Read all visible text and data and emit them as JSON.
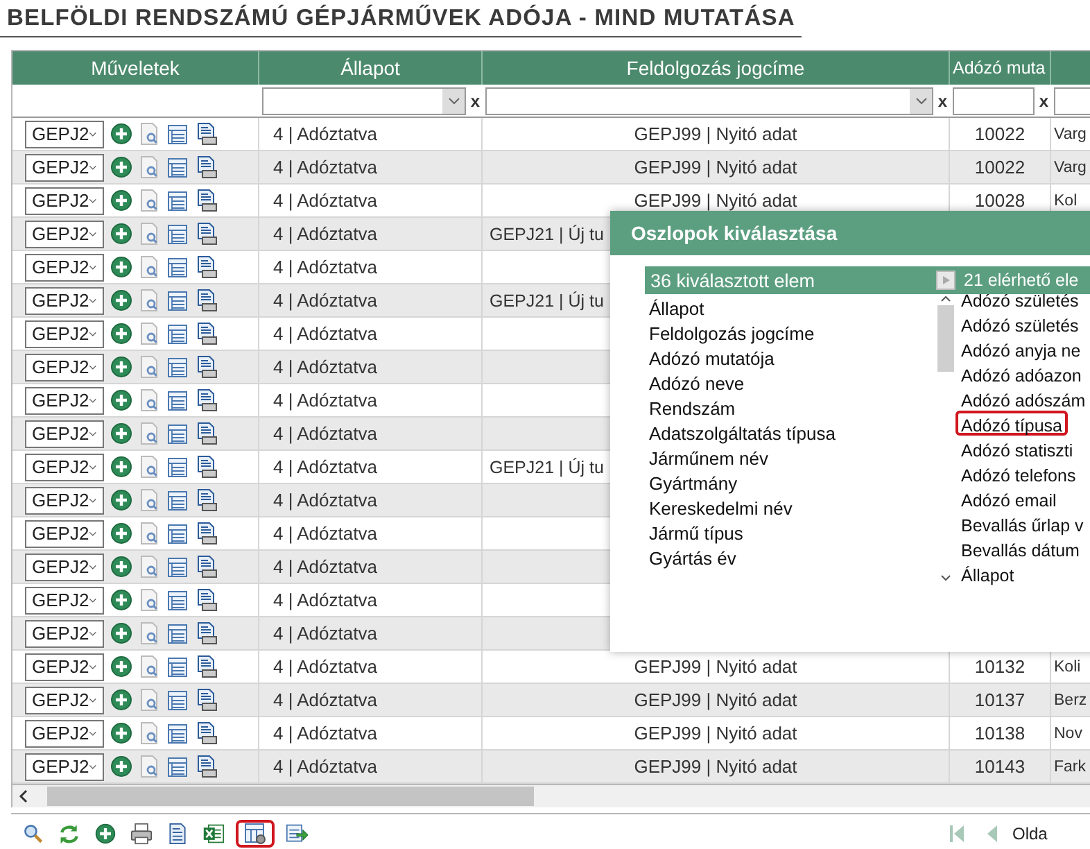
{
  "title": "BELFÖLDI RENDSZÁMÚ GÉPJÁRMŰVEK ADÓJA - MIND MUTATÁSA",
  "table": {
    "columns": [
      {
        "label": "Műveletek",
        "kind": "none"
      },
      {
        "label": "Állapot",
        "kind": "select",
        "clear": "x"
      },
      {
        "label": "Feldolgozás jogcíme",
        "kind": "select",
        "clear": "x"
      },
      {
        "label": "Adózó muta",
        "kind": "text",
        "clear": "x"
      },
      {
        "kind": "text"
      }
    ],
    "rows": [
      {
        "action": "GEPJ2",
        "status": "4 | Adóztatva",
        "title": {
          "text": "GEPJ99 | Nyitó adat",
          "cut": false
        },
        "taxpayer_id": "10022",
        "column_5": "Varg"
      },
      {
        "action": "GEPJ2",
        "status": "4 | Adóztatva",
        "title": {
          "text": "GEPJ99 | Nyitó adat",
          "cut": false
        },
        "taxpayer_id": "10022",
        "column_5": "Varg"
      },
      {
        "action": "GEPJ2",
        "status": "4 | Adóztatva",
        "title": {
          "text": "GEPJ99 | Nyitó adat",
          "cut": false
        },
        "taxpayer_id": "10028",
        "column_5": "Kol"
      },
      {
        "action": "GEPJ2",
        "status": "4 | Adóztatva",
        "title": {
          "text": "GEPJ21 | Új tu",
          "cut": true
        }
      },
      {
        "action": "GEPJ2",
        "status": "4 | Adóztatva"
      },
      {
        "action": "GEPJ2",
        "status": "4 | Adóztatva",
        "title": {
          "text": "GEPJ21 | Új tu",
          "cut": true
        }
      },
      {
        "action": "GEPJ2",
        "status": "4 | Adóztatva"
      },
      {
        "action": "GEPJ2",
        "status": "4 | Adóztatva"
      },
      {
        "action": "GEPJ2",
        "status": "4 | Adóztatva"
      },
      {
        "action": "GEPJ2",
        "status": "4 | Adóztatva"
      },
      {
        "action": "GEPJ2",
        "status": "4 | Adóztatva",
        "title": {
          "text": "GEPJ21 | Új tu",
          "cut": true
        }
      },
      {
        "action": "GEPJ2",
        "status": "4 | Adóztatva"
      },
      {
        "action": "GEPJ2",
        "status": "4 | Adóztatva"
      },
      {
        "action": "GEPJ2",
        "status": "4 | Adóztatva"
      },
      {
        "action": "GEPJ2",
        "status": "4 | Adóztatva"
      },
      {
        "action": "GEPJ2",
        "status": "4 | Adóztatva"
      },
      {
        "action": "GEPJ2",
        "status": "4 | Adóztatva",
        "title": {
          "text": "GEPJ99 | Nyitó adat",
          "cut": false
        },
        "taxpayer_id": "10132",
        "column_5": "Koli"
      },
      {
        "action": "GEPJ2",
        "status": "4 | Adóztatva",
        "title": {
          "text": "GEPJ99 | Nyitó adat",
          "cut": false
        },
        "taxpayer_id": "10137",
        "column_5": "Berz"
      },
      {
        "action": "GEPJ2",
        "status": "4 | Adóztatva",
        "title": {
          "text": "GEPJ99 | Nyitó adat",
          "cut": false
        },
        "taxpayer_id": "10138",
        "column_5": "Nov"
      },
      {
        "action": "GEPJ2",
        "status": "4 | Adóztatva",
        "title": {
          "text": "GEPJ99 | Nyitó adat",
          "cut": false
        },
        "taxpayer_id": "10143",
        "column_5": "Fark"
      }
    ]
  },
  "dialog": {
    "title": "Oszlopok kiválasztása",
    "selected_header": "36 kiválasztott elem",
    "available_header": "21 elérhető ele",
    "selected_items": [
      "Állapot",
      "Feldolgozás jogcíme",
      "Adózó mutatója",
      "Adózó neve",
      "Rendszám",
      "Adatszolgáltatás típusa",
      "Járműnem név",
      "Gyártmány",
      "Kereskedelmi név",
      "Jármű típus",
      "Gyártás év"
    ],
    "available_items": [
      {
        "label": "Adózó születés",
        "highlighted": false
      },
      {
        "label": "Adózó születés",
        "highlighted": false
      },
      {
        "label": "Adózó anyja ne",
        "highlighted": false
      },
      {
        "label": "Adózó adóazon",
        "highlighted": false
      },
      {
        "label": "Adózó adószám",
        "highlighted": false
      },
      {
        "label": "Adózó típusa",
        "highlighted": true
      },
      {
        "label": "Adózó statiszti",
        "highlighted": false
      },
      {
        "label": "Adózó telefons",
        "highlighted": false
      },
      {
        "label": "Adózó email",
        "highlighted": false
      },
      {
        "label": "Bevallás űrlap v",
        "highlighted": false
      },
      {
        "label": "Bevallás dátum",
        "highlighted": false
      },
      {
        "label": "Állapot",
        "highlighted": false
      }
    ]
  },
  "toolbar": {
    "buttons": [
      {
        "kind": "search",
        "highlighted": false
      },
      {
        "kind": "refresh",
        "highlighted": false
      },
      {
        "kind": "add",
        "highlighted": false
      },
      {
        "kind": "print",
        "highlighted": false
      },
      {
        "kind": "document",
        "highlighted": false
      },
      {
        "kind": "excel",
        "highlighted": false
      },
      {
        "kind": "columns",
        "highlighted": true
      },
      {
        "kind": "export",
        "highlighted": false
      }
    ],
    "pager_label": "Olda"
  }
}
